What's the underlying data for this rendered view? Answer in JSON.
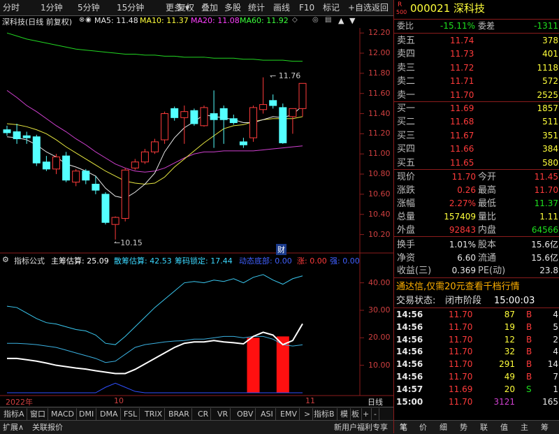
{
  "toolbar": {
    "left_items": [
      "分时",
      "1分钟",
      "5分钟",
      "15分钟",
      "更多"
    ],
    "right_items": [
      "复权",
      "叠加",
      "多股",
      "统计",
      "画线",
      "F10",
      "标记",
      "+自选",
      "返回"
    ]
  },
  "chart_header": {
    "stock": "深科技(日线 前复权)",
    "ma5_label": "MA5: 11.48",
    "ma10_label": "MA10: 11.37",
    "ma20_label": "MA20: 11.08",
    "ma60_label": "MA60: 11.92"
  },
  "price_axis": [
    "12.20",
    "12.00",
    "11.80",
    "11.60",
    "11.40",
    "11.20",
    "11.00",
    "10.80",
    "10.60",
    "10.40",
    "10.20"
  ],
  "annotations": {
    "high": "11.76",
    "low": "10.15",
    "cai": "财"
  },
  "indicator_header": {
    "name": "指标公式",
    "zcgs": "主筹估算: 25.09",
    "scgs": "散筹估算: 42.53",
    "cmsd": "筹码锁定: 17.44",
    "dtdb": "动态底部: 0.00",
    "zhang": "涨: 0.00",
    "qiang": "强: 0.00"
  },
  "indicator_axis": [
    "40.00",
    "30.00",
    "20.00",
    "10.00"
  ],
  "date_axis": {
    "y2022": "2022年",
    "m10": "10",
    "m11": "11",
    "period": "日线"
  },
  "bottom_tabs": [
    "指标A",
    "窗口",
    "MACD",
    "DMI",
    "DMA",
    "FSL",
    "TRIX",
    "BRAR",
    "CR",
    "VR",
    "OBV",
    "ASI",
    "EMV",
    ">",
    "指标B",
    "模",
    "板",
    "+",
    "-"
  ],
  "status_bar": {
    "left": [
      "扩展∧",
      "关联报价"
    ],
    "right": [
      "新用户福利专享",
      "笔",
      "价",
      "细",
      "势",
      "联",
      "值",
      "主",
      "筹"
    ]
  },
  "quote": {
    "market_tag": "R",
    "market_num": "500",
    "code_name": "000021 深科技",
    "weibi_label": "委比",
    "weibi": "-15.11%",
    "weicha_label": "委差",
    "weicha": "-1311",
    "asks": [
      {
        "label": "卖五",
        "price": "11.74",
        "vol": "378"
      },
      {
        "label": "卖四",
        "price": "11.73",
        "vol": "401"
      },
      {
        "label": "卖三",
        "price": "11.72",
        "vol": "1118"
      },
      {
        "label": "卖二",
        "price": "11.71",
        "vol": "572"
      },
      {
        "label": "卖一",
        "price": "11.70",
        "vol": "2525"
      }
    ],
    "bids": [
      {
        "label": "买一",
        "price": "11.69",
        "vol": "1857"
      },
      {
        "label": "买二",
        "price": "11.68",
        "vol": "511"
      },
      {
        "label": "买三",
        "price": "11.67",
        "vol": "351"
      },
      {
        "label": "买四",
        "price": "11.66",
        "vol": "384"
      },
      {
        "label": "买五",
        "price": "11.65",
        "vol": "580"
      }
    ],
    "stats": [
      {
        "l1": "现价",
        "v1": "11.70",
        "l2": "今开",
        "v2": "11.45",
        "c1": "red",
        "c2": "red"
      },
      {
        "l1": "涨跌",
        "v1": "0.26",
        "l2": "最高",
        "v2": "11.70",
        "c1": "red",
        "c2": "red"
      },
      {
        "l1": "涨幅",
        "v1": "2.27%",
        "l2": "最低",
        "v2": "11.37",
        "c1": "red",
        "c2": "green"
      },
      {
        "l1": "总量",
        "v1": "157409",
        "l2": "量比",
        "v2": "1.11",
        "c1": "yellow",
        "c2": "yellow"
      },
      {
        "l1": "外盘",
        "v1": "92843",
        "l2": "内盘",
        "v2": "64566",
        "c1": "red",
        "c2": "green"
      }
    ],
    "stats2": [
      {
        "l1": "换手",
        "v1": "1.01%",
        "l2": "股本",
        "v2": "15.6亿"
      },
      {
        "l1": "净资",
        "v1": "6.60",
        "l2": "流通",
        "v2": "15.6亿"
      },
      {
        "l1": "收益(三)",
        "v1": "0.369",
        "l2": "PE(动)",
        "v2": "23.8"
      }
    ],
    "promo": "通达信,仅需20元查看千档行情",
    "trade_status_label": "交易状态:",
    "trade_status": "闭市阶段",
    "trade_time": "15:00:03",
    "ticks": [
      {
        "t": "14:56",
        "p": "11.70",
        "v": "87",
        "d": "B",
        "n": "4",
        "vc": "yellow",
        "dc": "red"
      },
      {
        "t": "14:56",
        "p": "11.70",
        "v": "19",
        "d": "B",
        "n": "5",
        "vc": "yellow",
        "dc": "red"
      },
      {
        "t": "14:56",
        "p": "11.70",
        "v": "12",
        "d": "B",
        "n": "2",
        "vc": "yellow",
        "dc": "red"
      },
      {
        "t": "14:56",
        "p": "11.70",
        "v": "32",
        "d": "B",
        "n": "4",
        "vc": "yellow",
        "dc": "red"
      },
      {
        "t": "14:56",
        "p": "11.70",
        "v": "291",
        "d": "B",
        "n": "14",
        "vc": "yellow",
        "dc": "red"
      },
      {
        "t": "14:56",
        "p": "11.70",
        "v": "49",
        "d": "B",
        "n": "7",
        "vc": "yellow",
        "dc": "red"
      },
      {
        "t": "14:57",
        "p": "11.69",
        "v": "20",
        "d": "S",
        "n": "1",
        "vc": "yellow",
        "dc": "green"
      },
      {
        "t": "15:00",
        "p": "11.70",
        "v": "3121",
        "d": "",
        "n": "165",
        "vc": "magenta",
        "dc": "white"
      }
    ]
  },
  "colors": {
    "up": "#ff3b3b",
    "down": "#54ffff",
    "bg": "#000000",
    "border": "#8b1c1c"
  },
  "chart_data": {
    "type": "candlestick",
    "ohlc": [
      [
        11.24,
        11.28,
        11.18,
        11.21
      ],
      [
        11.22,
        11.3,
        11.1,
        11.15
      ],
      [
        11.18,
        11.22,
        11.1,
        11.16
      ],
      [
        11.17,
        11.19,
        10.88,
        10.91
      ],
      [
        10.92,
        10.98,
        10.83,
        10.85
      ],
      [
        10.85,
        11.0,
        10.8,
        10.97
      ],
      [
        10.98,
        11.02,
        10.72,
        10.74
      ],
      [
        10.72,
        10.85,
        10.68,
        10.83
      ],
      [
        10.83,
        10.85,
        10.7,
        10.74
      ],
      [
        10.7,
        10.78,
        10.6,
        10.64
      ],
      [
        10.6,
        10.62,
        10.3,
        10.32
      ],
      [
        10.3,
        10.38,
        10.15,
        10.37
      ],
      [
        10.36,
        10.86,
        10.33,
        10.84
      ],
      [
        10.86,
        10.95,
        10.84,
        10.92
      ],
      [
        10.92,
        11.05,
        10.9,
        11.02
      ],
      [
        11.02,
        11.15,
        11.0,
        11.12
      ],
      [
        11.14,
        11.42,
        11.1,
        11.4
      ],
      [
        11.45,
        11.47,
        11.33,
        11.36
      ],
      [
        11.36,
        11.48,
        11.1,
        11.42
      ],
      [
        11.43,
        11.45,
        11.28,
        11.3
      ],
      [
        11.28,
        11.48,
        11.27,
        11.46
      ],
      [
        11.4,
        11.63,
        11.06,
        11.34
      ],
      [
        11.45,
        11.48,
        11.1,
        11.34
      ],
      [
        11.35,
        11.39,
        11.29,
        11.31
      ],
      [
        11.12,
        11.16,
        11.06,
        11.09
      ],
      [
        11.16,
        11.48,
        11.12,
        11.46
      ],
      [
        11.44,
        11.76,
        11.4,
        11.49
      ],
      [
        11.53,
        11.59,
        11.45,
        11.48
      ],
      [
        11.46,
        11.5,
        11.1,
        11.11
      ],
      [
        11.37,
        11.45,
        11.2,
        11.45
      ],
      [
        11.45,
        11.7,
        11.37,
        11.7
      ]
    ],
    "ma5": [
      11.17,
      11.16,
      11.14,
      11.09,
      11.02,
      10.97,
      10.9,
      10.87,
      10.83,
      10.78,
      10.66,
      10.58,
      10.56,
      10.62,
      10.7,
      10.81,
      11.02,
      11.16,
      11.26,
      11.32,
      11.39,
      11.37,
      11.36,
      11.34,
      11.31,
      11.31,
      11.34,
      11.37,
      11.36,
      11.39,
      11.48
    ],
    "ma10": [
      11.3,
      11.29,
      11.27,
      11.24,
      11.2,
      11.14,
      11.07,
      11.01,
      10.95,
      10.89,
      10.83,
      10.78,
      10.73,
      10.71,
      10.7,
      10.71,
      10.77,
      10.87,
      10.95,
      11.03,
      11.11,
      11.18,
      11.25,
      11.28,
      11.29,
      11.32,
      11.34,
      11.35,
      11.35,
      11.35,
      11.37
    ],
    "ma20": [
      11.63,
      11.56,
      11.48,
      11.42,
      11.35,
      11.28,
      11.22,
      11.15,
      11.09,
      11.02,
      10.96,
      10.9,
      10.86,
      10.83,
      10.82,
      10.83,
      10.86,
      10.91,
      10.96,
      11.0,
      11.02,
      11.02,
      11.03,
      11.03,
      11.03,
      11.03,
      11.04,
      11.05,
      11.06,
      11.07,
      11.08
    ],
    "ma60": [
      12.2,
      12.17,
      12.14,
      12.12,
      12.1,
      12.08,
      12.06,
      12.04,
      12.03,
      12.02,
      12.01,
      12.0,
      11.99,
      11.99,
      11.98,
      11.98,
      11.97,
      11.97,
      11.96,
      11.96,
      11.96,
      11.95,
      11.95,
      11.95,
      11.94,
      11.94,
      11.93,
      11.93,
      11.93,
      11.92,
      11.92
    ],
    "indicator": {
      "zcgs": [
        12.5,
        12.5,
        12.0,
        11.5,
        10.8,
        10.0,
        9.5,
        9.0,
        8.6,
        8.0,
        7.5,
        7.0,
        7.0,
        8.5,
        10.5,
        12.5,
        14.5,
        16.5,
        18.0,
        18.5,
        18.5,
        19.0,
        18.5,
        18.2,
        17.8,
        20.5,
        22.0,
        21.0,
        17.5,
        19.0,
        25.09
      ],
      "scgs": [
        31.5,
        31.0,
        29.0,
        27.0,
        25.5,
        25.0,
        24.0,
        23.0,
        22.5,
        21.0,
        18.0,
        17.5,
        20.5,
        24.0,
        27.5,
        31.0,
        34.0,
        37.0,
        40.0,
        40.5,
        40.0,
        41.0,
        40.5,
        41.5,
        40.0,
        42.0,
        43.0,
        41.0,
        39.5,
        41.5,
        42.53
      ],
      "cmsd": [
        18.0,
        18.0,
        17.8,
        17.5,
        17.0,
        16.5,
        15.5,
        14.5,
        13.5,
        12.5,
        11.0,
        11.5,
        14.0,
        16.5,
        17.5,
        18.0,
        18.5,
        18.8,
        19.0,
        19.5,
        19.5,
        20.0,
        20.5,
        20.5,
        20.0,
        20.5,
        20.5,
        19.5,
        17.5,
        17.0,
        17.44
      ],
      "dtdb": [
        0,
        0,
        0,
        0,
        0,
        0,
        0,
        0,
        0,
        0,
        2.0,
        3.5,
        2.0,
        0.5,
        0,
        0,
        0,
        0,
        0,
        0,
        0,
        0,
        0,
        0,
        0,
        0,
        0,
        0,
        0,
        0,
        0
      ],
      "zhang_bars": [
        {
          "i": 25,
          "v": 20
        },
        {
          "i": 28,
          "v": 20.5
        }
      ],
      "ylim": [
        0,
        45
      ]
    },
    "ylim": [
      10.1,
      12.25
    ]
  }
}
